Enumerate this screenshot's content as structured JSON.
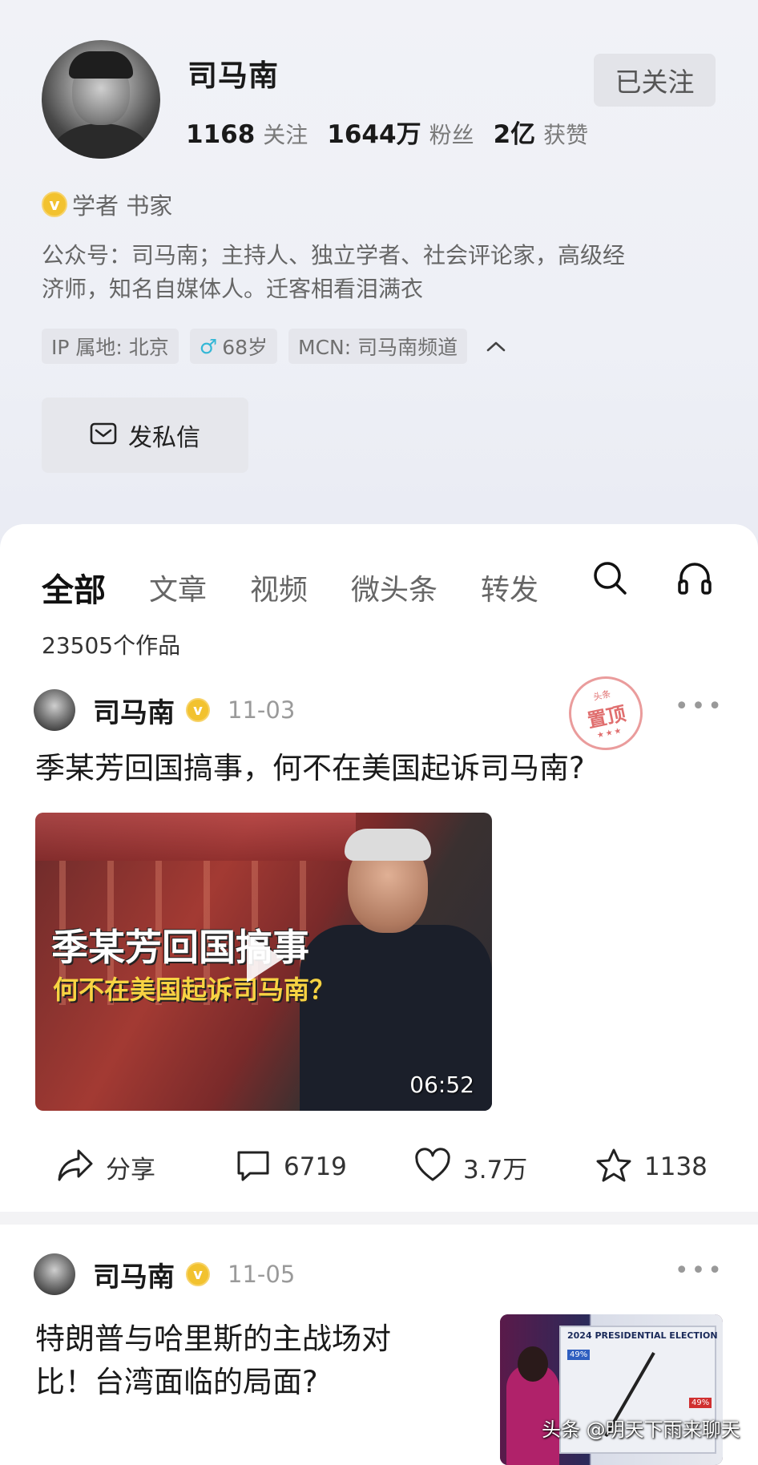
{
  "profile": {
    "name": "司马南",
    "stats": [
      {
        "num": "1168",
        "label": "关注"
      },
      {
        "num": "1644万",
        "label": "粉丝"
      },
      {
        "num": "2亿",
        "label": "获赞"
      }
    ],
    "follow_label": "已关注",
    "verify_text": "学者 书家",
    "bio_line1": "公众号：司马南；主持人、独立学者、社会评论家，高级经",
    "bio_line2": "济师，知名自媒体人。迁客相看泪满衣",
    "tags": {
      "ip": "IP 属地: 北京",
      "age": "68岁",
      "mcn": "MCN: 司马南频道"
    },
    "dm_label": "发私信"
  },
  "tabs": [
    "全部",
    "文章",
    "视频",
    "微头条",
    "转发"
  ],
  "works_count": "23505个作品",
  "posts": [
    {
      "author": "司马南",
      "date": "11-03",
      "pinned_stamp": {
        "top": "头条",
        "main": "置顶"
      },
      "title": "季某芳回国搞事，何不在美国起诉司马南?",
      "video": {
        "caption1": "季某芳回国搞事",
        "caption2": "何不在美国起诉司马南？",
        "duration": "06:52"
      },
      "actions": {
        "share": "分享",
        "comments": "6719",
        "likes": "3.7万",
        "favorites": "1138"
      }
    },
    {
      "author": "司马南",
      "date": "11-05",
      "title_line1": "特朗普与哈里斯的主战场对",
      "title_line2": "比！台湾面临的局面?",
      "thumb": {
        "headline": "2024 PRESIDENTIAL ELECTION",
        "pct_harris": "49%",
        "pct_trump": "49%"
      }
    }
  ],
  "watermark": "头条 @明天下雨来聊天",
  "colors": {
    "verify_gold": "#f2c22f",
    "male_blue": "#35b7d6",
    "stamp_red": "#d84b4b"
  }
}
